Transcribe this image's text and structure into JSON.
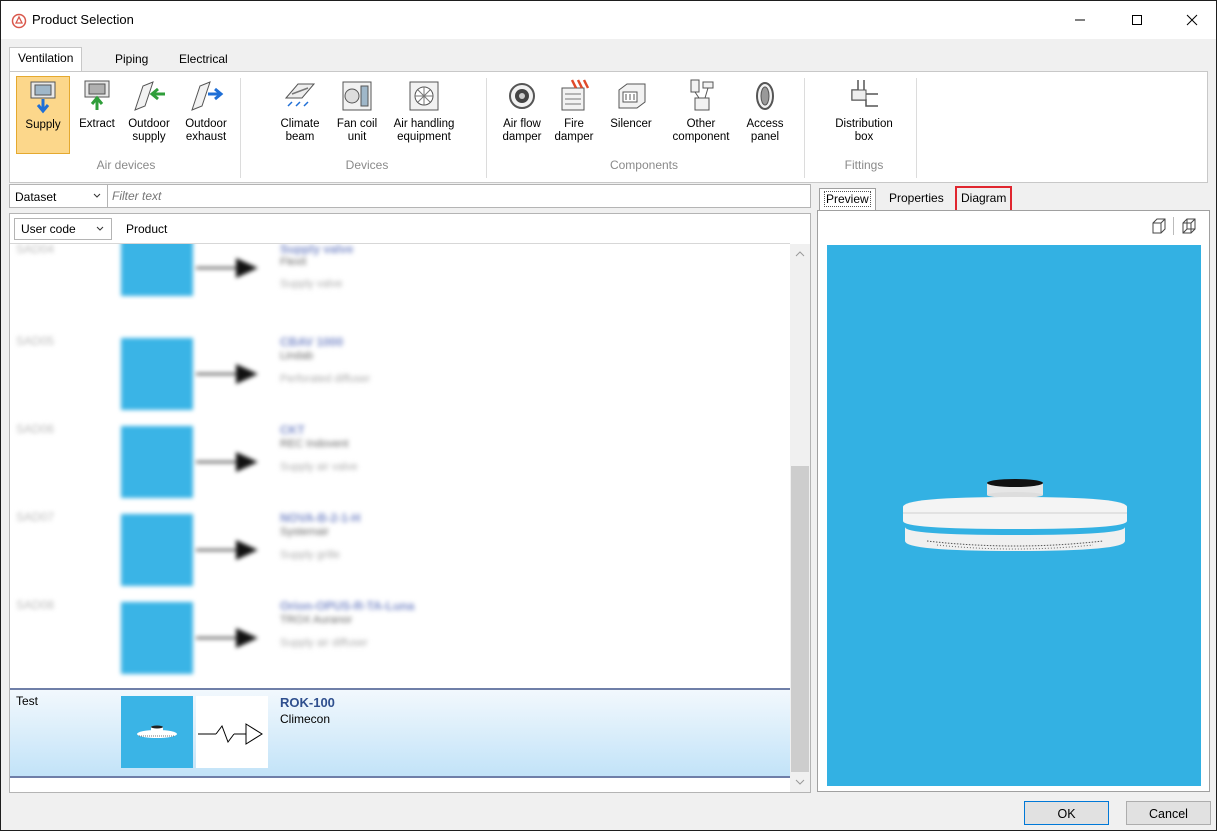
{
  "window": {
    "title": "Product Selection",
    "minimize": "–",
    "maximize": "☐",
    "close": "✕"
  },
  "tabs": [
    {
      "label": "Ventilation",
      "active": true
    },
    {
      "label": "Piping",
      "active": false
    },
    {
      "label": "Electrical",
      "active": false
    }
  ],
  "ribbon": {
    "groups": [
      {
        "label": "Air devices",
        "items": [
          {
            "label1": "Supply",
            "label2": "",
            "selected": true,
            "icon": "supply-icon"
          },
          {
            "label1": "Extract",
            "label2": "",
            "selected": false,
            "icon": "extract-icon"
          },
          {
            "label1": "Outdoor",
            "label2": "supply",
            "selected": false,
            "icon": "outdoor-supply-icon"
          },
          {
            "label1": "Outdoor",
            "label2": "exhaust",
            "selected": false,
            "icon": "outdoor-exhaust-icon"
          }
        ]
      },
      {
        "label": "Devices",
        "items": [
          {
            "label1": "Climate",
            "label2": "beam",
            "icon": "climate-beam-icon"
          },
          {
            "label1": "Fan coil",
            "label2": "unit",
            "icon": "fan-coil-icon"
          },
          {
            "label1": "Air handling",
            "label2": "equipment",
            "icon": "air-handling-icon"
          }
        ]
      },
      {
        "label": "Components",
        "items": [
          {
            "label1": "Air flow",
            "label2": "damper",
            "icon": "air-flow-damper-icon"
          },
          {
            "label1": "Fire",
            "label2": "damper",
            "icon": "fire-damper-icon"
          },
          {
            "label1": "Silencer",
            "label2": "",
            "icon": "silencer-icon"
          },
          {
            "label1": "Other",
            "label2": "component",
            "icon": "other-component-icon"
          },
          {
            "label1": "Access",
            "label2": "panel",
            "icon": "access-panel-icon"
          }
        ]
      },
      {
        "label": "Fittings",
        "items": [
          {
            "label1": "Distribution",
            "label2": "box",
            "icon": "distribution-box-icon"
          }
        ]
      }
    ]
  },
  "filter": {
    "dataset": "Dataset",
    "placeholder": "Filter text"
  },
  "list": {
    "usercode_label": "User code",
    "product_label": "Product",
    "blurred_rows": [
      {
        "code": "SAD04",
        "name": "Supply valve",
        "maker": "Flexit",
        "type": "Supply valve"
      },
      {
        "code": "SAD05",
        "name": "CBAV 1000",
        "maker": "Lindab",
        "type": "Perforated diffuser"
      },
      {
        "code": "SAD06",
        "name": "CKT",
        "maker": "REC Indovent",
        "type": "Supply air valve"
      },
      {
        "code": "SAD07",
        "name": "NOVA-B-2-1-H",
        "maker": "Systemair",
        "type": "Supply grille"
      },
      {
        "code": "SAD08",
        "name": "Orion-OPUS-R-TA-Luna",
        "maker": "TROX Auranor",
        "type": "Supply air diffuser"
      }
    ],
    "selected": {
      "code": "Test",
      "name": "ROK-100",
      "maker": "Climecon"
    }
  },
  "right": {
    "tabs": [
      {
        "label": "Preview",
        "active": true
      },
      {
        "label": "Properties",
        "active": false
      },
      {
        "label": "Diagram",
        "active": false,
        "highlighted": true
      }
    ],
    "preview_bg": "#33b1e3"
  },
  "buttons": {
    "ok": "OK",
    "cancel": "Cancel"
  },
  "colors": {
    "selected_ribbon": "#fcd78b",
    "highlight_border": "#e0262f",
    "product_name": "#2f4f8e"
  }
}
